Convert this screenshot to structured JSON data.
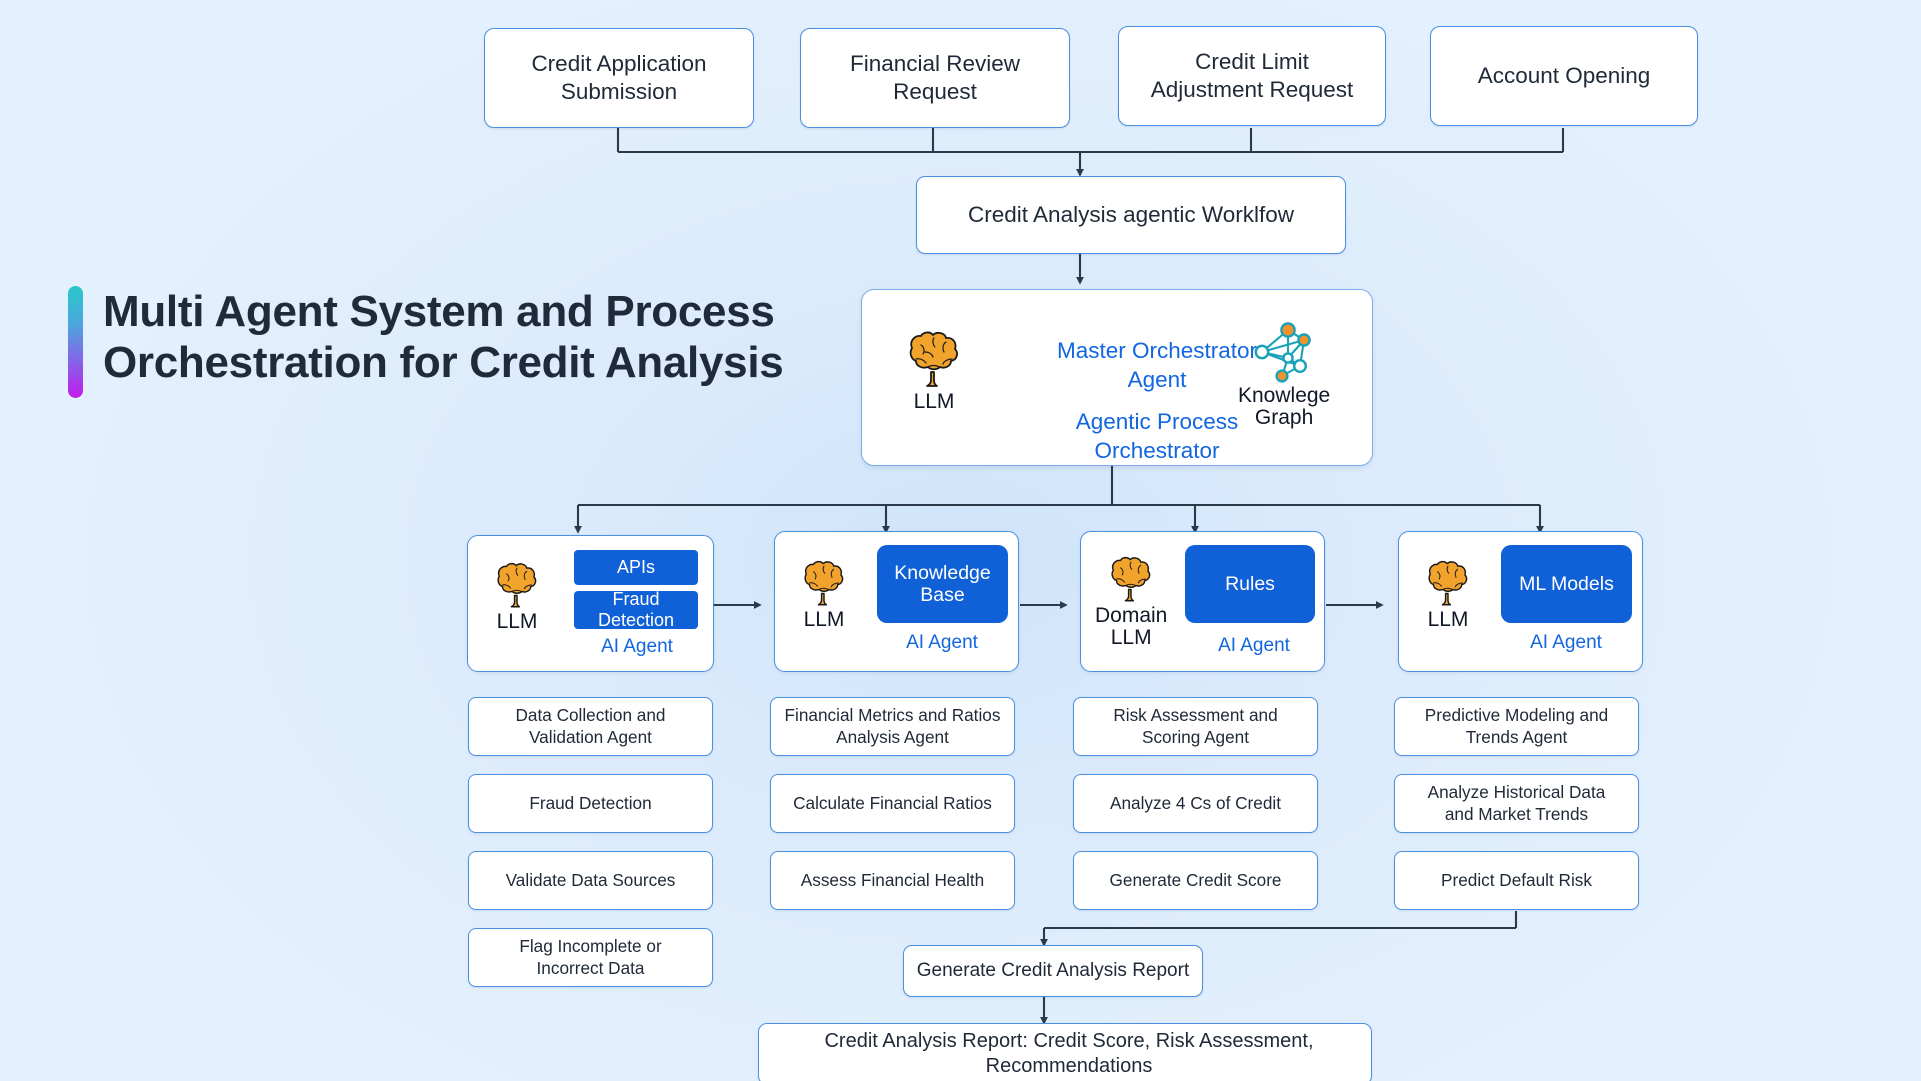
{
  "title": {
    "text": "Multi Agent System and Process\nOrchestration for Credit Analysis",
    "accent_from": "#29c8c8",
    "accent_to": "#c11ceb"
  },
  "colors": {
    "background": "#e2effc",
    "node_border": "#4a8fe0",
    "chip_blue": "#1060d8",
    "link_blue": "#1266e0",
    "brain_orange": "#f2a32b",
    "graph_teal": "#17a2b8",
    "arrow": "#2b3a4a"
  },
  "sources": [
    {
      "label": "Credit Application\nSubmission"
    },
    {
      "label": "Financial Review\nRequest"
    },
    {
      "label": "Credit Limit\nAdjustment Request"
    },
    {
      "label": "Account Opening"
    }
  ],
  "workflow": {
    "label": "Credit Analysis agentic Worklfow"
  },
  "orchestrator": {
    "llm_caption": "LLM",
    "line1": "Master Orchestrator Agent",
    "line2": "Agentic Process\nOrchestrator",
    "graph_caption": "Knowlege\nGraph",
    "brain_icon": "brain-icon",
    "graph_icon": "knowledge-graph-icon"
  },
  "agents": [
    {
      "llm_caption": "LLM",
      "chips": [
        "APIs",
        "Fraud Detection"
      ],
      "agent_label": "AI Agent",
      "tasks": [
        "Data Collection and\nValidation Agent",
        "Fraud Detection",
        "Validate Data Sources",
        "Flag Incomplete or\nIncorrect Data"
      ]
    },
    {
      "llm_caption": "LLM",
      "chips": [
        "Knowledge\nBase"
      ],
      "agent_label": "AI Agent",
      "tasks": [
        "Financial Metrics and Ratios\nAnalysis Agent",
        "Calculate Financial Ratios",
        "Assess Financial Health"
      ]
    },
    {
      "llm_caption": "Domain\nLLM",
      "chips": [
        "Rules"
      ],
      "agent_label": "AI Agent",
      "tasks": [
        "Risk Assessment and\nScoring Agent",
        "Analyze 4 Cs of Credit",
        "Generate Credit Score"
      ]
    },
    {
      "llm_caption": "LLM",
      "chips": [
        "ML Models"
      ],
      "agent_label": "AI Agent",
      "tasks": [
        "Predictive Modeling and\nTrends Agent",
        "Analyze Historical Data\nand Market Trends",
        "Predict Default Risk"
      ]
    }
  ],
  "generate_report": {
    "label": "Generate Credit Analysis Report"
  },
  "final_report": {
    "label": "Credit Analysis Report: Credit Score, Risk Assessment, Recommendations"
  }
}
